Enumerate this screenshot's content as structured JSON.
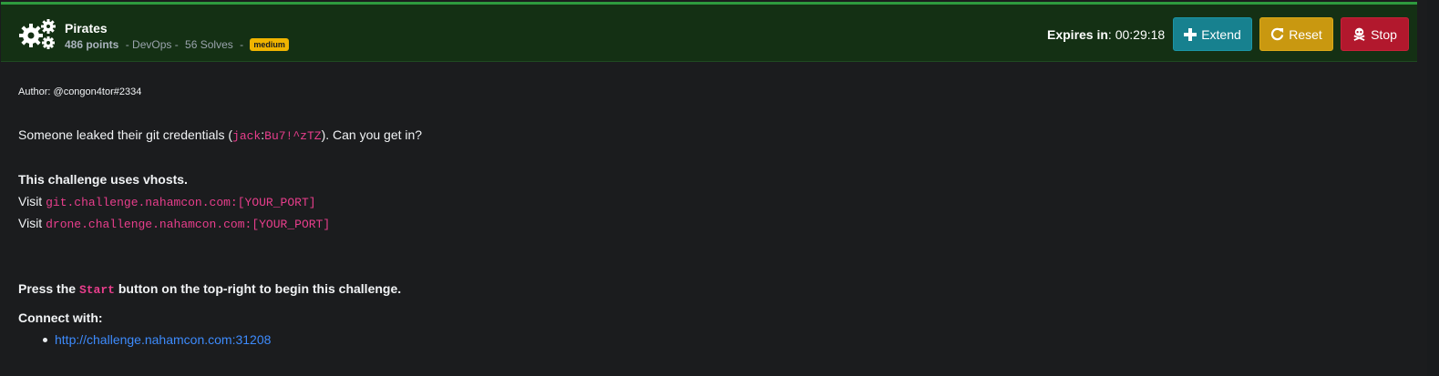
{
  "header": {
    "title": "Pirates",
    "points": "486 points",
    "category": " - DevOps - ",
    "solves": "56 Solves",
    "sep": " - ",
    "difficulty": "medium",
    "expires_label": "Expires in",
    "expires_value": ": 00:29:18",
    "buttons": {
      "extend": "Extend",
      "reset": "Reset",
      "stop": "Stop"
    }
  },
  "content": {
    "author": "Author: @congon4tor#2334",
    "leak_prefix": "Someone leaked their git credentials (",
    "leak_user": "jack",
    "leak_colon": ":",
    "leak_pass": "Bu7!^zTZ",
    "leak_suffix": "). Can you get in?",
    "vhost_heading": "This challenge uses vhosts.",
    "visit_label": "Visit",
    "vhost_1": "git.challenge.nahamcon.com:[YOUR_PORT]",
    "vhost_2": "drone.challenge.nahamcon.com:[YOUR_PORT]",
    "press_prefix": "Press the ",
    "press_code": "Start",
    "press_suffix": " button on the top-right to begin this challenge.",
    "connect_label": "Connect with:",
    "connect_link": "http://challenge.nahamcon.com:31208"
  },
  "colors": {
    "header_bg": "#143014",
    "accent_green": "#2e9a3e",
    "extend": "#17818f",
    "reset": "#c99810",
    "stop": "#b2182d",
    "code": "#e83e8c",
    "link": "#3d8bfd",
    "badge": "#f0b400"
  },
  "icons": {
    "challenge": "gears-icon",
    "extend": "plus-icon",
    "reset": "redo-icon",
    "stop": "skull-crossbones-icon"
  }
}
